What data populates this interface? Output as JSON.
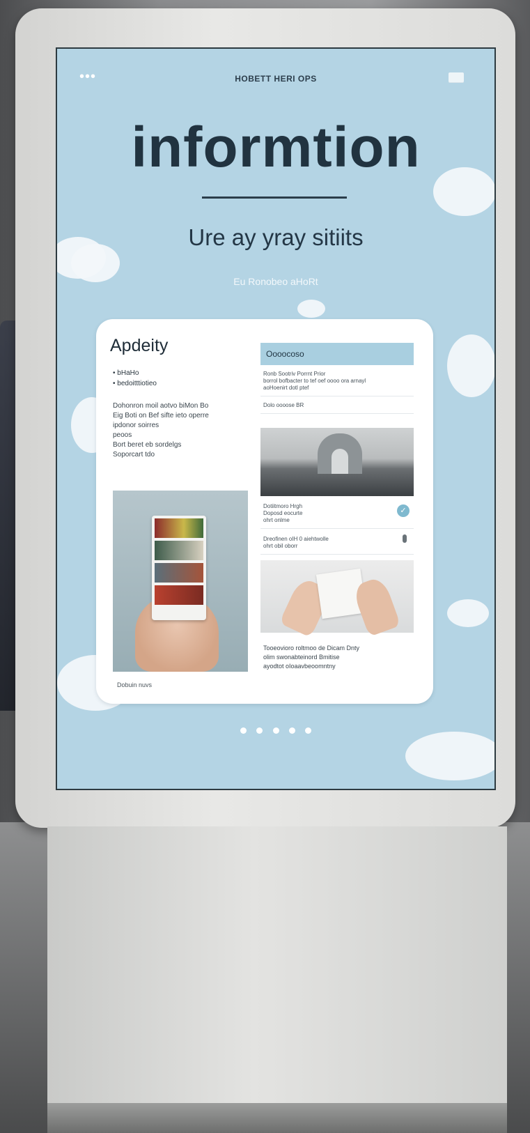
{
  "screen": {
    "top_title": "HOBETT HERI OPS",
    "headline": "informtion",
    "subheadline": "Ure ay yray sitiits",
    "tagline": "Eu Ronobeo aHoRt",
    "pager_count": 5
  },
  "card": {
    "title": "Apdeity",
    "bullets": [
      "bHaHo",
      "bedoitttiotieo"
    ],
    "paragraph": [
      "Dohonron moil aotvo biMon Bo",
      "Eig Boti on Bef sifte ieto operre",
      "ipdonor soirres",
      "peoos",
      "Bort beret eb sordelgs",
      "Soporcart tdo"
    ],
    "left_caption": "Dobuin nuvs",
    "right_panel": {
      "header": "Oooocoso",
      "block1": [
        "Ronb Sootriv Porrnt Prior",
        "borrol bofbacter to tef oef oooo ora arnayl",
        "aoHoenirt dotl ptef"
      ],
      "block2": "Dolo oooose BR",
      "item1": [
        "Dotiitmoro Hrgh",
        "Doposd eocurte",
        "ohrt onlme"
      ],
      "item2": [
        "Dreofinen oIH 0 aiehtwolle",
        "ohrt obil oborr"
      ],
      "bottom_text": [
        "Tooeovioro roltmoo de Dicam Dnty",
        "olim swonabteinord Bmitise",
        "ayodtot oIoaavbeoomntny"
      ]
    }
  },
  "icons": {
    "menu": "dots-icon",
    "display": "screen-icon",
    "badge": "info-badge-icon",
    "mic": "mic-icon"
  },
  "colors": {
    "screen_bg": "#b4d4e4",
    "headline": "#213340",
    "panel_header": "#a9cfe0"
  }
}
